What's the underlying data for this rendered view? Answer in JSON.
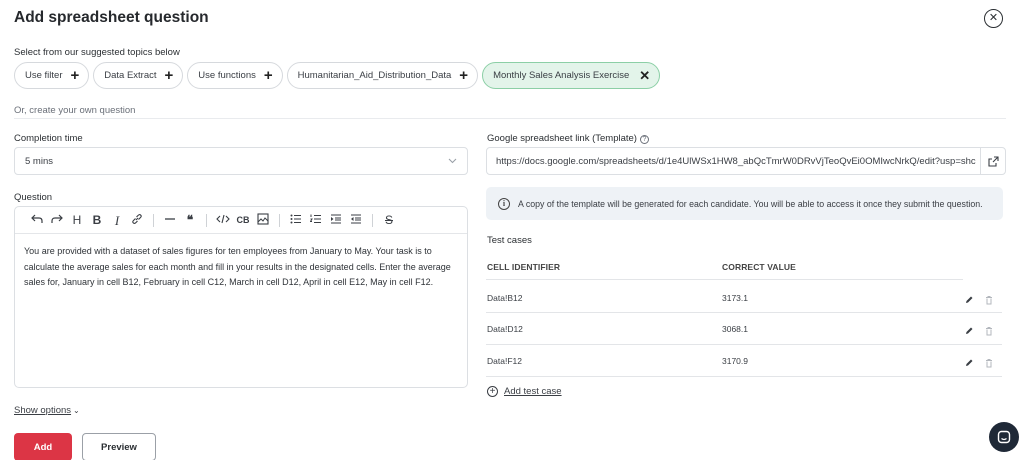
{
  "dialog": {
    "title": "Add spreadsheet question",
    "close_icon": "close-circle-icon"
  },
  "topics": {
    "label": "Select from our suggested topics below",
    "items": [
      {
        "label": "Use filter",
        "selected": false
      },
      {
        "label": "Data Extract",
        "selected": false
      },
      {
        "label": "Use functions",
        "selected": false
      },
      {
        "label": "Humanitarian_Aid_Distribution_Data",
        "selected": false
      },
      {
        "label": "Monthly Sales Analysis Exercise",
        "selected": true
      }
    ],
    "plus_glyph": "+",
    "remove_glyph": "✕"
  },
  "or_label": "Or, create your own question",
  "completion_time": {
    "label": "Completion time",
    "value": "5 mins"
  },
  "question": {
    "label": "Question",
    "toolbar": [
      "undo",
      "redo",
      "heading",
      "bold",
      "italic",
      "link",
      "horizontal-rule",
      "quote",
      "code",
      "code-block",
      "image",
      "bullet-list",
      "ordered-list",
      "indent",
      "outdent",
      "strikethrough"
    ],
    "text": "You are provided with a dataset of sales figures for ten employees from January to May. Your task is to calculate the average sales for each month and fill in your results in the designated cells. Enter the average sales for, January in cell B12, February in cell C12, March in cell D12, April in cell E12, May in cell F12."
  },
  "show_options": "Show options",
  "actions": {
    "add": "Add",
    "preview": "Preview"
  },
  "template_link": {
    "label": "Google spreadsheet link (Template)",
    "value": "https://docs.google.com/spreadsheets/d/1e4UlWSx1HW8_abQcTmrW0DRvVjTeoQvEi0OMIwcNrkQ/edit?usp=shc"
  },
  "info_text": "A copy of the template will be generated for each candidate. You will be able to access it once they submit the question.",
  "test_cases": {
    "title": "Test cases",
    "columns": [
      "CELL IDENTIFIER",
      "CORRECT VALUE"
    ],
    "rows": [
      {
        "cell": "Data!B12",
        "value": "3173.1"
      },
      {
        "cell": "Data!D12",
        "value": "3068.1"
      },
      {
        "cell": "Data!F12",
        "value": "3170.9"
      }
    ],
    "add_label": "Add test case"
  },
  "colors": {
    "primary": "#dc3545",
    "selected_chip_bg": "#e3f4ea",
    "selected_chip_border": "#8ccfa6",
    "info_bg": "#eef2f6",
    "chat_bubble": "#1f2937"
  }
}
